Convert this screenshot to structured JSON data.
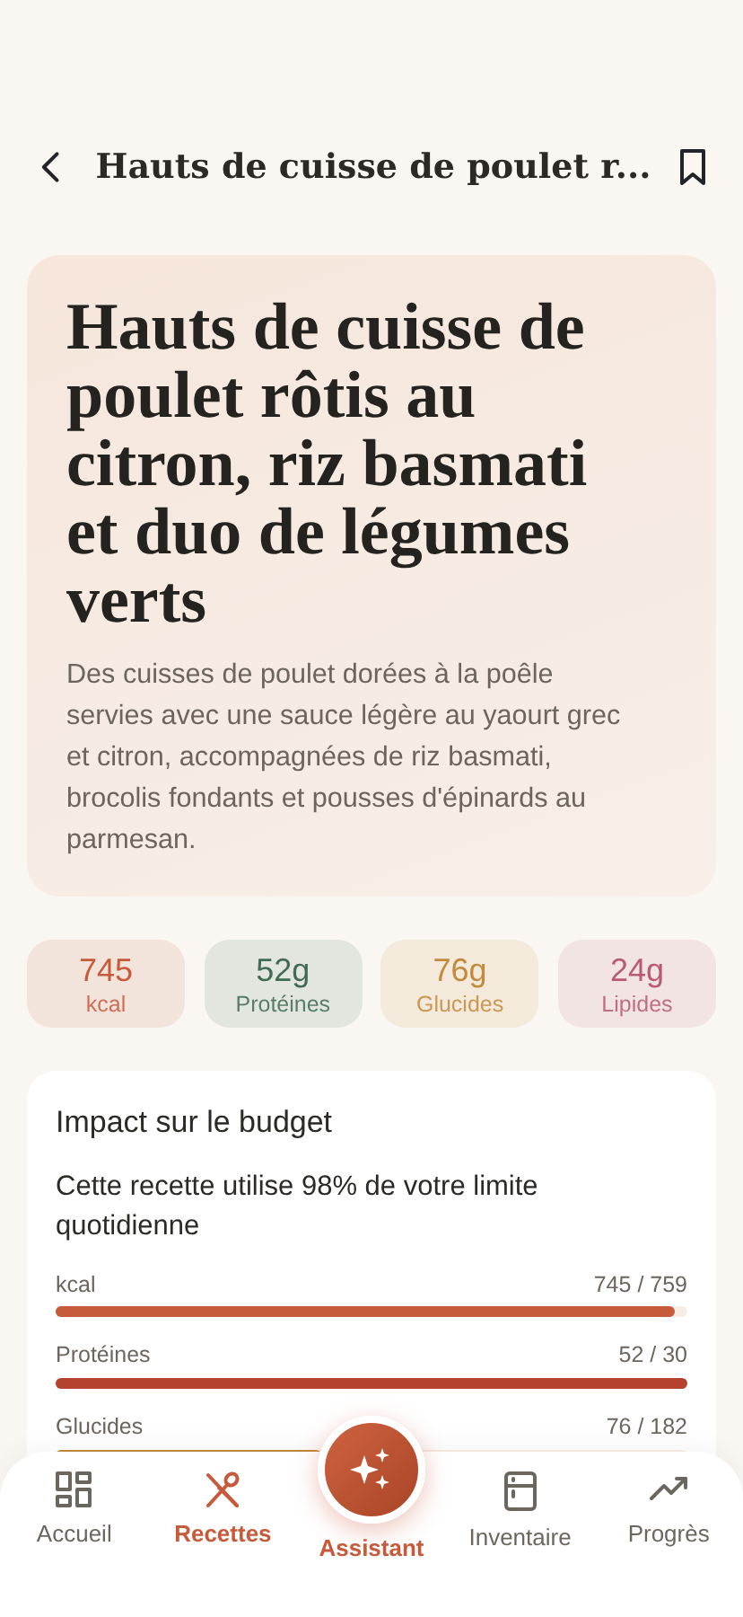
{
  "header": {
    "title": "Hauts de cuisse de poulet r..."
  },
  "hero": {
    "title": "Hauts de cuisse de poulet rôtis au citron, riz basmati et duo de légumes verts",
    "description": "Des cuisses de poulet dorées à la poêle servies avec une sauce légère au yaourt grec et citron, accompagnées de riz basmati, brocolis fondants et pousses d'épinards au parmesan."
  },
  "macros": [
    {
      "value": "745",
      "label": "kcal",
      "color": "#c85a3c"
    },
    {
      "value": "52g",
      "label": "Protéines",
      "color": "#3f6b52"
    },
    {
      "value": "76g",
      "label": "Glucides",
      "color": "#c48a3c"
    },
    {
      "value": "24g",
      "label": "Lipides",
      "color": "#b85a74"
    }
  ],
  "budget": {
    "title": "Impact sur le budget",
    "summary": "Cette recette utilise 98% de votre limite quotidienne",
    "rows": [
      {
        "label": "kcal",
        "reading": "745 / 759",
        "level": 0.98,
        "color": "#c85a3c"
      },
      {
        "label": "Protéines",
        "reading": "52 / 30",
        "level": 1,
        "color": "#b5412f"
      },
      {
        "label": "Glucides",
        "reading": "76 / 182",
        "level": 0.42,
        "color": "#c48a3c"
      }
    ]
  },
  "nav": [
    {
      "label": "Accueil",
      "kind": "grid",
      "selected": false
    },
    {
      "label": "Recettes",
      "kind": "utensils",
      "selected": true
    },
    {
      "label": "Assistant",
      "kind": "assistant",
      "selected": false
    },
    {
      "label": "Inventaire",
      "kind": "fridge",
      "selected": false
    },
    {
      "label": "Progrès",
      "kind": "trend",
      "selected": false
    }
  ]
}
